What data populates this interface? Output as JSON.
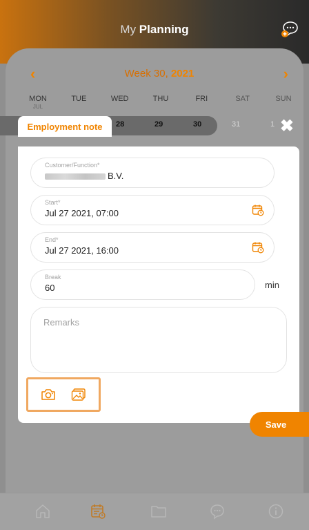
{
  "header": {
    "title_light": "My ",
    "title_bold": "Planning",
    "chat_icon": "chat-add-icon"
  },
  "week": {
    "label_light": "Week 30, ",
    "label_bold": "2021",
    "prev_icon": "chevron-left-icon",
    "next_icon": "chevron-right-icon"
  },
  "days": [
    {
      "name": "MON",
      "sub": "JUL"
    },
    {
      "name": "TUE",
      "sub": ""
    },
    {
      "name": "WED",
      "sub": ""
    },
    {
      "name": "THU",
      "sub": ""
    },
    {
      "name": "FRI",
      "sub": ""
    },
    {
      "name": "SAT",
      "sub": ""
    },
    {
      "name": "SUN",
      "sub": ""
    }
  ],
  "dates": [
    "28",
    "29",
    "30",
    "31",
    "1"
  ],
  "modal": {
    "tab_label": "Employment note",
    "close_icon": "close-icon",
    "customer": {
      "label": "Customer/Function*",
      "value": "B.V."
    },
    "start": {
      "label": "Start*",
      "value": "Jul 27 2021, 07:00"
    },
    "end": {
      "label": "End*",
      "value": "Jul 27 2021, 16:00"
    },
    "break": {
      "label": "Break",
      "value": "60",
      "unit": "min"
    },
    "remarks": {
      "placeholder": "Remarks"
    },
    "save_label": "Save"
  },
  "accent_color": "#f08400",
  "bottom_nav": [
    "home-icon",
    "planning-calendar-icon",
    "folder-icon",
    "chat-icon",
    "info-icon"
  ]
}
